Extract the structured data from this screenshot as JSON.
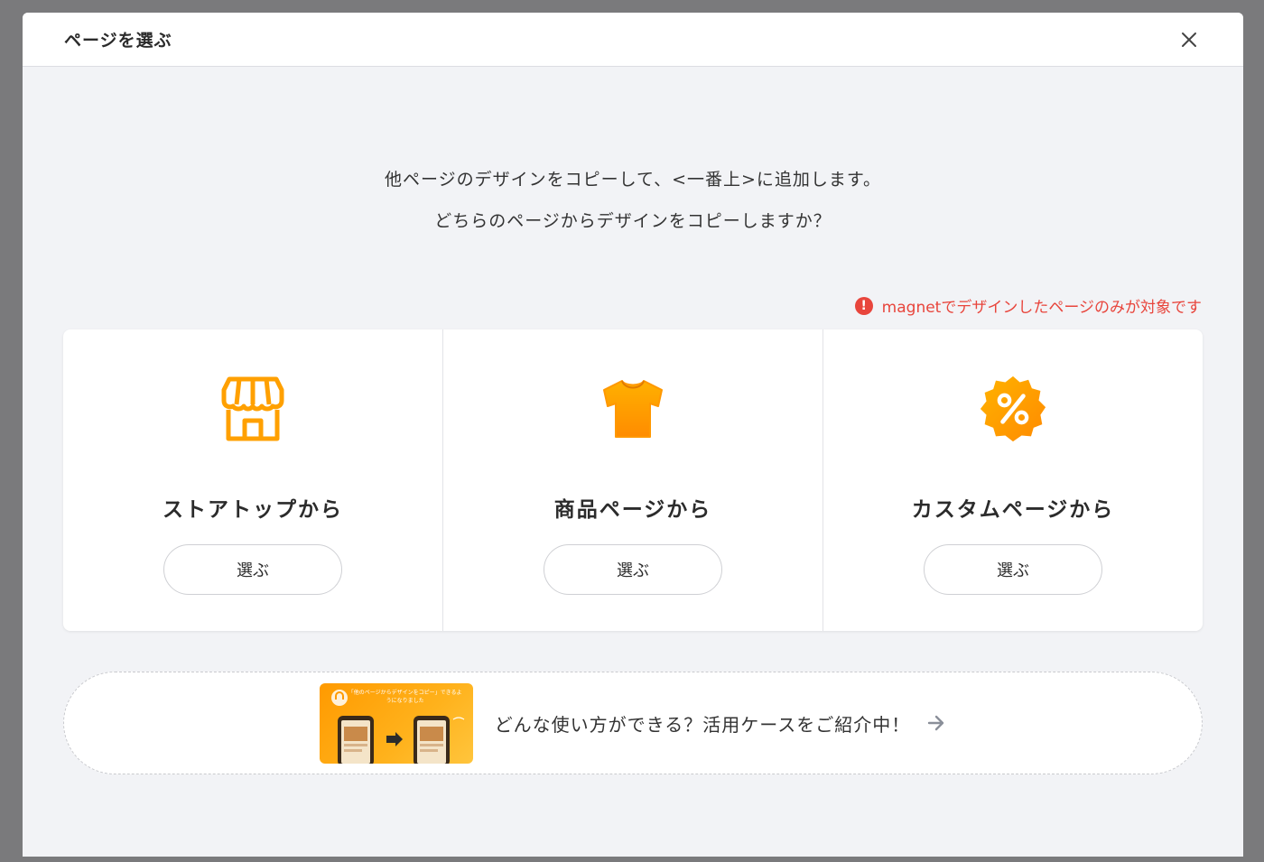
{
  "modal": {
    "title": "ページを選ぶ",
    "close_icon": "close-icon"
  },
  "intro": {
    "line1": "他ページのデザインをコピーして、<一番上>に追加します。",
    "line2": "どちらのページからデザインをコピーしますか？"
  },
  "notice": {
    "icon": "alert-circle-icon",
    "text": "magnetでデザインしたページのみが対象です",
    "color": "#e8453c"
  },
  "cards": [
    {
      "icon": "storefront-icon",
      "title": "ストアトップから",
      "button": "選ぶ"
    },
    {
      "icon": "tshirt-icon",
      "title": "商品ページから",
      "button": "選ぶ"
    },
    {
      "icon": "percent-badge-icon",
      "title": "カスタムページから",
      "button": "選ぶ"
    }
  ],
  "banner": {
    "thumbnail_caption": "「他のページからデザインをコピー」できるようになりました",
    "text": "どんな使い方ができる？活用ケースをご紹介中！",
    "arrow_icon": "arrow-right-icon"
  },
  "colors": {
    "accent": "#ff9f00",
    "overlay": "#7a7a7c",
    "modal_bg": "#f2f3f6"
  }
}
